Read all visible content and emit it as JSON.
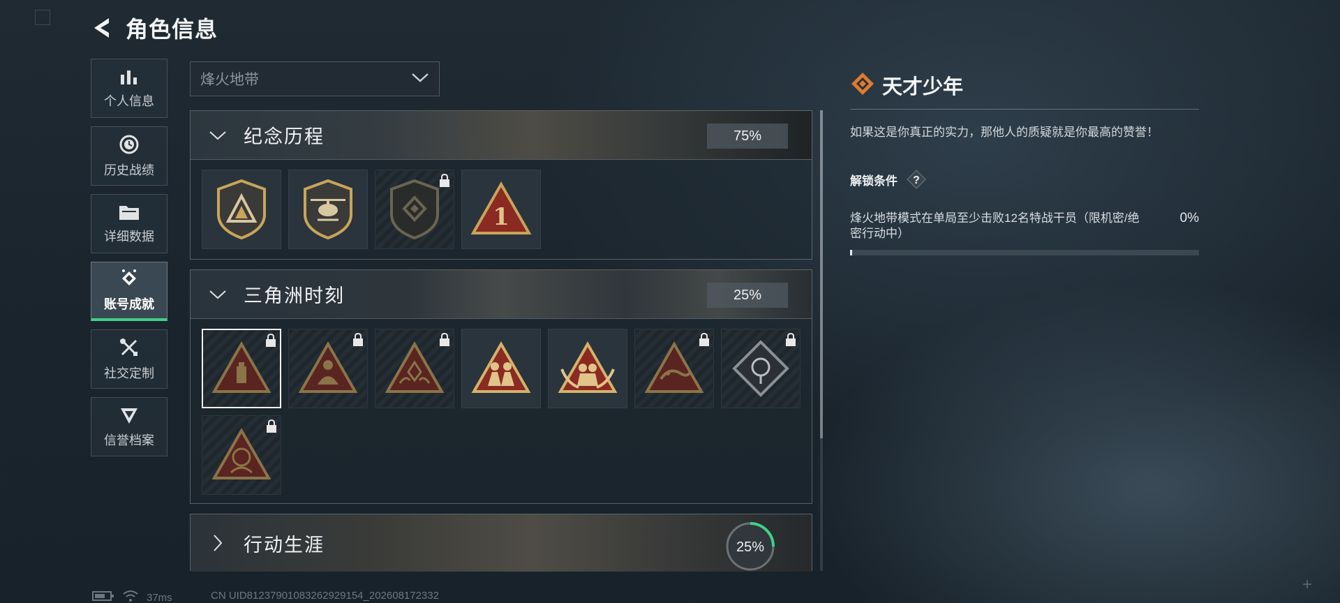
{
  "page": {
    "title": "角色信息"
  },
  "sidebar": {
    "items": [
      {
        "label": "个人信息",
        "icon": "bar-chart-icon",
        "active": false
      },
      {
        "label": "历史战绩",
        "icon": "clock-icon",
        "active": false
      },
      {
        "label": "详细数据",
        "icon": "folder-icon",
        "active": false
      },
      {
        "label": "账号成就",
        "icon": "achievement-icon",
        "active": true
      },
      {
        "label": "社交定制",
        "icon": "wrench-screwdriver-icon",
        "active": false
      },
      {
        "label": "信誉档案",
        "icon": "shield-wing-icon",
        "active": false
      }
    ]
  },
  "filter": {
    "selected": "烽火地带"
  },
  "sections": [
    {
      "title": "纪念历程",
      "progress": "75%",
      "expanded": true,
      "badge_count": 4,
      "locked": [
        false,
        false,
        true,
        false
      ]
    },
    {
      "title": "三角洲时刻",
      "progress": "25%",
      "expanded": true,
      "badge_count": 8,
      "locked": [
        true,
        true,
        true,
        false,
        false,
        true,
        true,
        true
      ]
    },
    {
      "title": "行动生涯",
      "progress": "25%",
      "expanded": false,
      "progress_value": 0.25
    }
  ],
  "detail": {
    "title": "天才少年",
    "description": "如果这是你真正的实力，那他人的质疑就是你最高的赞誉！",
    "unlock_label": "解锁条件",
    "condition": "烽火地带模式在单局至少击败12名特战干员（限机密/绝密行动中）",
    "condition_progress": "0%",
    "condition_value": 0.0
  },
  "status": {
    "ping": "37ms",
    "uid": "CN UID81237901083262929154_202608172332"
  },
  "colors": {
    "accent_green": "#3fd08a",
    "accent_orange": "#e07a2e",
    "badge_gold": "#c9a45a",
    "badge_red": "#8a2a22"
  }
}
